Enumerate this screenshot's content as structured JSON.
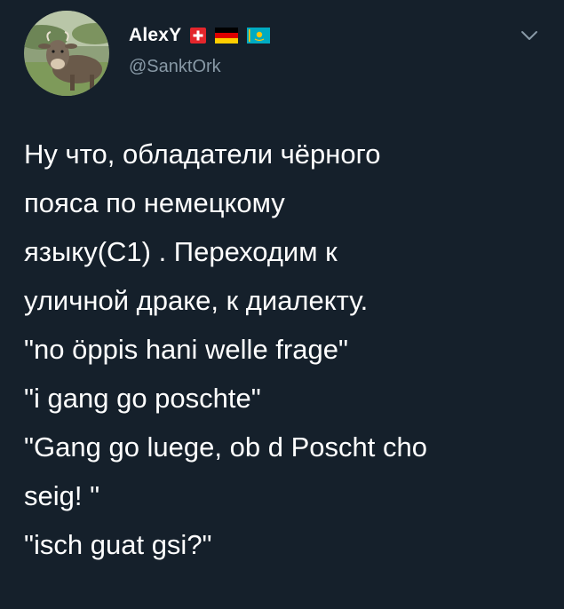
{
  "author": {
    "display_name": "AlexY",
    "handle": "@SanktOrk",
    "avatar_icon": "cow-avatar",
    "flags": [
      "flag-switzerland-icon",
      "flag-germany-icon",
      "flag-kazakhstan-icon"
    ]
  },
  "menu": {
    "icon": "chevron-down-icon"
  },
  "tweet": {
    "lines": [
      "Ну что, обладатели чёрного",
      "пояса по немецкому",
      "языку(С1) . Переходим к",
      "уличной драке, к диалекту.",
      "\"no öppis hani welle frage\"",
      "\"i gang go poschte\"",
      "\"Gang go luege, ob d Poscht cho",
      "seig! \"",
      "\"isch guat gsi?\""
    ]
  },
  "colors": {
    "background": "#15202b",
    "text": "#ffffff",
    "secondary_text": "#8899a6"
  }
}
